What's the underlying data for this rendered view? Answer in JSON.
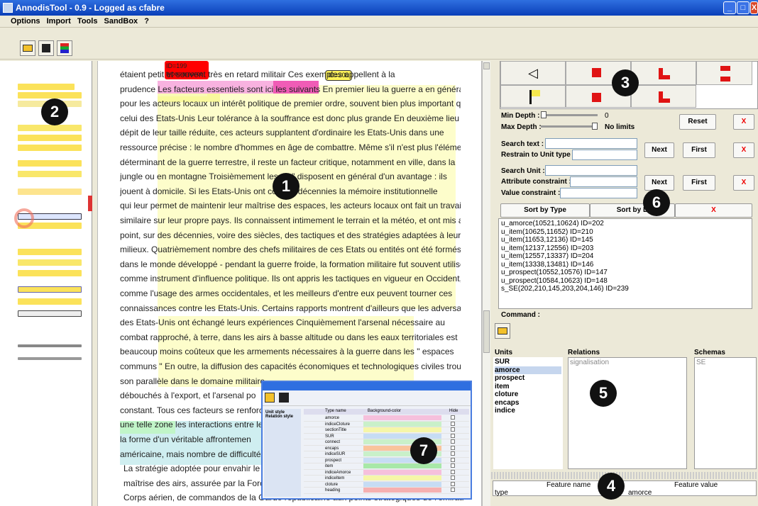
{
  "window": {
    "title": "AnnodisTool - 0.9 - Logged as cfabre"
  },
  "menu": [
    "Options",
    "Import",
    "Tools",
    "SandBox",
    "?"
  ],
  "document": {
    "lines": [
      "étaient petit                           et souvent très en retard militair            Ces exemples appellent à la",
      "prudence  Les facteurs essentiels sont ici les suivants  En premier lieu  la guerre a en général",
      "pour les acteurs locaux un intérêt politique de premier ordre, souvent bien plus important que",
      "celui des Etats-Unis  Leur tolérance à la souffrance  est donc plus grande  En deuxième lieu  en",
      "dépit de leur taille réduite, ces acteurs supplantent d'ordinaire les Etats-Unis dans une",
      "ressource précise : le nombre d'hommes en âge de combattre. Même s'il n'est plus l'élément",
      "déterminant de la guerre terrestre,  il  reste un facteur critique, notamment en ville, dans la",
      "jungle ou en montagne  Troisièmement   les                 ux \" disposent en général d'un avantage : ils",
      "jouent à domicile. Si les Etats-Unis ont cor            des décennies la mémoire institutionnelle",
      "qui leur permet de maintenir leur maîtrise des espaces, les acteurs locaux ont fait un travail",
      "similaire sur leur propre pays.  Ils  connaissent intimement le terrain et la météo, et ont mis au",
      "point, sur des décennies, voire des siècles, des tactiques et des stratégies adaptées à leurs",
      "milieux.  Quatrièmement  nombre des chefs militaires de ces Etats ou entités ont été formés",
      "dans le monde développé - pendant la guerre froide, la formation militaire fut souvent utilisée",
      "comme instrument d'influence politique.  Ils  ont appris les tactiques en vigueur en Occident,",
      "comme l'usage des armes occidentales, et les meilleurs d'entre eux peuvent tourner ces",
      "connaissances contre les Etats-Unis. Certains rapports montrent d'ailleurs que les adversaires",
      "des Etats-Unis ont échangé leurs expériences  Cinquièmement  l'arsenal nécessaire au",
      "combat rapproché, à terre, dans les airs à basse altitude ou dans les eaux territoriales est",
      "beaucoup moins coûteux que les armements nécessaires à la guerre dans les \" espaces",
      "communs \" En outre, la diffusion des capacités économiques et technologiques civiles trouve",
      "son parallèle dans le domaine militaire",
      "débouchés à l'export,  et  l'arsenal po",
      "constant.  Tous ces facteurs se renforc",
      "une telle zone  les interactions entre le",
      "la forme d'un véritable affrontemen",
      "américaine, mais nombre de difficultés.",
      "La stratégie adoptée pour envahir le",
      "maîtrise des airs, assurée par la Force",
      "Corps aérien, de commandos de la Garde républicaine aux points stratégiques de l'émirat."
    ],
    "tag_red": {
      "id": "ID=199",
      "type": "type=amorce"
    },
    "tag_yellow": "ID=200"
  },
  "controls": {
    "min_depth_label": "Min Depth :",
    "min_depth_value": "0",
    "max_depth_label": "Max Depth :",
    "max_depth_value": "No limits",
    "reset": "Reset",
    "x": "X",
    "search_text_label": "Search text :",
    "restrain_label": "Restrain to Unit type :",
    "next": "Next",
    "first": "First",
    "search_unit_label": "Search Unit :",
    "attr_label": "Attribute constraint :",
    "value_label": "Value constraint :",
    "sort_type": "Sort by Type",
    "sort_d": "Sort by D",
    "command_label": "Command :"
  },
  "unit_list": [
    "u_amorce(10521,10624) ID=202",
    "u_item(10625,11652) ID=210",
    "u_item(11653,12136) ID=145",
    "u_item(12137,12556) ID=203",
    "u_item(12557,13337) ID=204",
    "u_item(13338,13481) ID=146",
    "u_prospect(10552,10576) ID=147",
    "u_prospect(10584,10623) ID=148",
    "s_SE(202,210,145,203,204,146) ID=239"
  ],
  "panels": {
    "units_title": "Units",
    "relations_title": "Relations",
    "schemas_title": "Schemas",
    "units": [
      "SUR",
      "amorce",
      "prospect",
      "item",
      "cloture",
      "encaps",
      "indice"
    ],
    "relations": [
      "signalisation"
    ],
    "schemas": [
      "SE"
    ]
  },
  "features": {
    "name_header": "Feature name",
    "value_header": "Feature value",
    "name": "type",
    "value": "amorce"
  },
  "inset": {
    "tab1": "Unit style",
    "tab2": "Relation style",
    "col_type": "Type name",
    "col_bg": "Background-color",
    "col_hide": "Hide",
    "rows": [
      "amorce",
      "indiceCloture",
      "sectionTitle",
      "SUR",
      "connect",
      "encaps",
      "indiceSUR",
      "prospect",
      "item",
      "indiceAmorce",
      "indiceItem",
      "cloture",
      "heading"
    ]
  },
  "badges": [
    "1",
    "2",
    "3",
    "4",
    "5",
    "6",
    "7"
  ]
}
